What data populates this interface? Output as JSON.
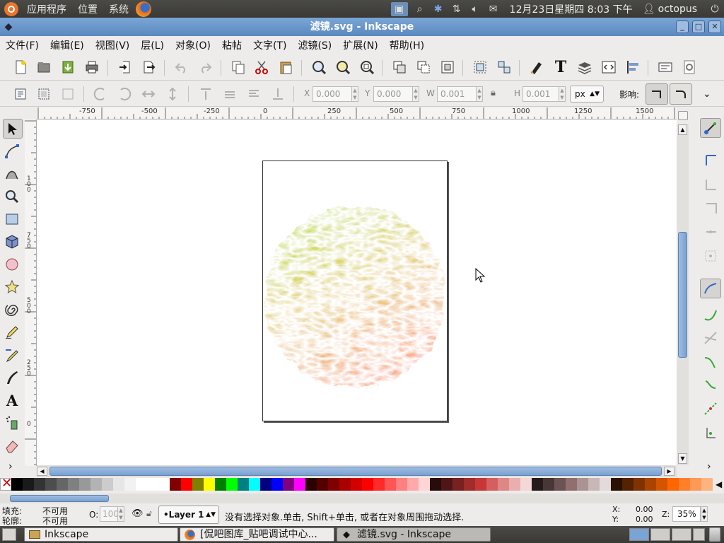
{
  "top_panel": {
    "menus": [
      "应用程序",
      "位置",
      "系统"
    ],
    "datetime": "12月23日星期四  8:03 下午",
    "user": "octopus"
  },
  "window": {
    "title": "滤镜.svg - Inkscape"
  },
  "menubar": [
    "文件(F)",
    "编辑(E)",
    "视图(V)",
    "层(L)",
    "对象(O)",
    "粘帖",
    "文字(T)",
    "滤镜(S)",
    "扩展(N)",
    "帮助(H)"
  ],
  "controls": {
    "x_label": "X",
    "x_value": "0.000",
    "y_label": "Y",
    "y_value": "0.000",
    "w_label": "W",
    "w_value": "0.001",
    "h_label": "H",
    "h_value": "0.001",
    "unit": "px",
    "affect_label": "影响:"
  },
  "ruler_top_labels": [
    "-750",
    "-500",
    "-250",
    "0",
    "250",
    "500",
    "750",
    "1000",
    "1250",
    "1500"
  ],
  "ruler_left_labels": [
    "100",
    "750",
    "500",
    "250",
    "0"
  ],
  "palette_colors": [
    "#000000",
    "#1a1a1a",
    "#333333",
    "#4d4d4d",
    "#666666",
    "#808080",
    "#999999",
    "#b3b3b3",
    "#cccccc",
    "#e6e6e6",
    "#f2f2f2",
    "#ffffff",
    "#ffffff",
    "#ffffff",
    "#800000",
    "#ff0000",
    "#808000",
    "#ffff00",
    "#008000",
    "#00ff00",
    "#008080",
    "#00ffff",
    "#000080",
    "#0000ff",
    "#800080",
    "#ff00ff",
    "#2b0000",
    "#550000",
    "#800000",
    "#aa0000",
    "#d40000",
    "#ff0000",
    "#ff2a2a",
    "#ff5555",
    "#ff8080",
    "#ffaaaa",
    "#ffd5d5",
    "#280b0b",
    "#501616",
    "#782121",
    "#a02c2c",
    "#c83737",
    "#d35f5f",
    "#de8787",
    "#e9afaf",
    "#f4d7d7",
    "#241c1c",
    "#483737",
    "#6c5353",
    "#916f6f",
    "#ac9393",
    "#c8b7b7",
    "#e3dbdb",
    "#2b1100",
    "#552200",
    "#803300",
    "#aa4400",
    "#d45500",
    "#ff6600",
    "#ff7f2a",
    "#ff9955",
    "#ffb380"
  ],
  "status": {
    "fill_label": "填充:",
    "fill_value": "不可用",
    "stroke_label": "轮廓:",
    "stroke_value": "不可用",
    "opacity_label": "O:",
    "opacity_value": "100",
    "layer": "•Layer 1",
    "message": "没有选择对象.单击, Shift+单击, 或者在对象周围拖动选择.",
    "x_label": "X:",
    "x_value": "0.00",
    "y_label": "Y:",
    "y_value": "0.00",
    "zoom_label": "Z:",
    "zoom_value": "35%"
  },
  "taskbar": {
    "tasks": [
      "Inkscape",
      "[侃吧图库_贴吧调试中心...",
      "滤镜.svg - Inkscape"
    ]
  }
}
